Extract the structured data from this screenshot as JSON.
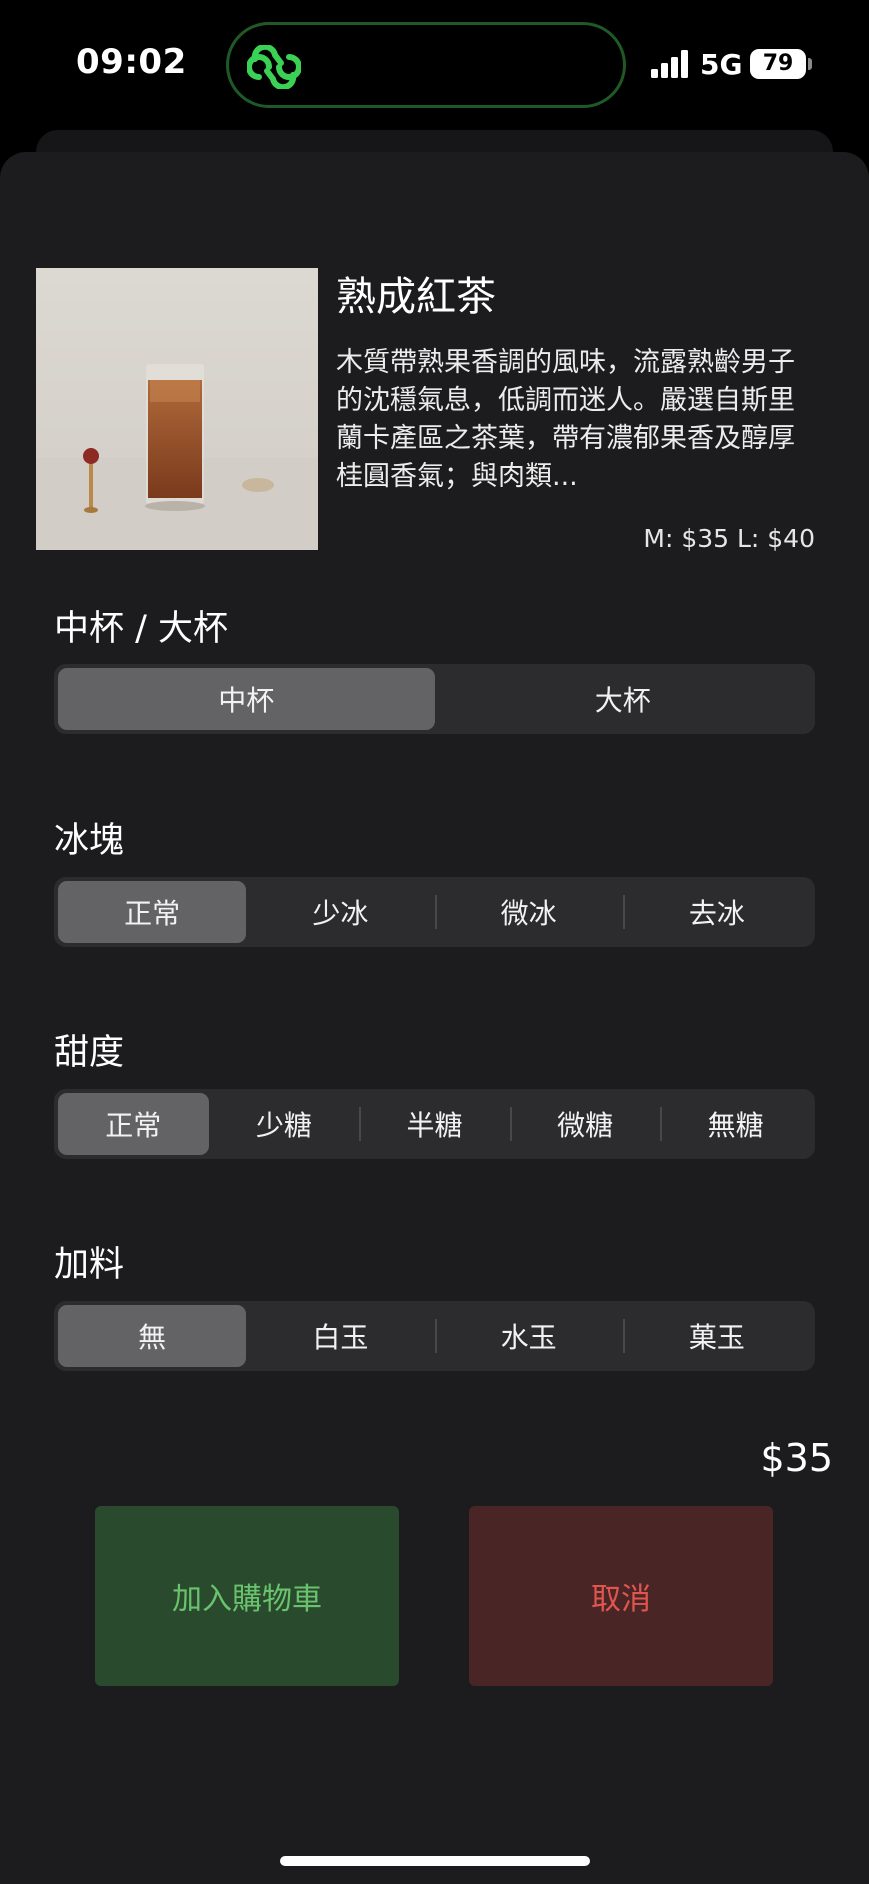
{
  "status_bar": {
    "time": "09:02",
    "network": "5G",
    "battery": "79",
    "island_icon": "link-icon",
    "accent_color": "#3bd154"
  },
  "product": {
    "name": "熟成紅茶",
    "description": "木質帶熟果香調的風味，流露熟齡男子的沈穩氣息，低調而迷人。嚴選自斯里蘭卡產區之茶葉，帶有濃郁果香及醇厚桂圓香氣；與肉類...",
    "price": "M: $35 L: $40",
    "image": "iced-black-tea-glass-photo"
  },
  "options": {
    "size": {
      "title": "中杯 / 大杯",
      "choices": [
        "中杯",
        "大杯"
      ],
      "selected": "中杯"
    },
    "ice": {
      "title": "冰塊",
      "choices": [
        "正常",
        "少冰",
        "微冰",
        "去冰"
      ],
      "selected": "正常"
    },
    "sweetness": {
      "title": "甜度",
      "choices": [
        "正常",
        "少糖",
        "半糖",
        "微糖",
        "無糖"
      ],
      "selected": "正常"
    },
    "topping": {
      "title": "加料",
      "choices": [
        "無",
        "白玉",
        "水玉",
        "菓玉"
      ],
      "selected": "無"
    }
  },
  "total": "$35",
  "actions": {
    "add_to_cart": "加入購物車",
    "cancel": "取消"
  },
  "colors": {
    "sheet_bg": "#1c1c1e",
    "segment_bg": "#2c2c2f",
    "segment_selected": "#636366",
    "add_button_bg": "#2a4a2d",
    "add_button_text": "#69c36e",
    "cancel_button_bg": "#4a2526",
    "cancel_button_text": "#e0564f"
  }
}
